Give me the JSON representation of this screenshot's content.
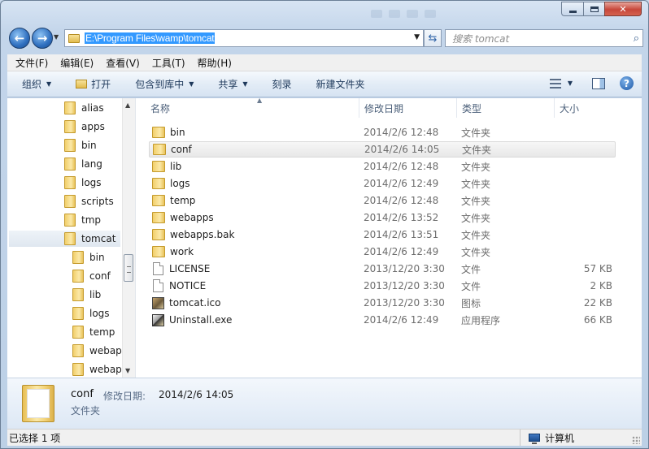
{
  "window": {
    "caption": {
      "minimize": "—",
      "maximize": "□",
      "close": "✕"
    }
  },
  "address": {
    "path": "E:\\Program Files\\wamp\\tomcat",
    "back_icon": "arrow-left-icon",
    "forward_icon": "arrow-right-icon",
    "refresh_icon": "refresh-icon"
  },
  "search": {
    "placeholder": "搜索 tomcat"
  },
  "menu": [
    "文件(F)",
    "编辑(E)",
    "查看(V)",
    "工具(T)",
    "帮助(H)"
  ],
  "toolbar": {
    "organize": "组织",
    "open": "打开",
    "include_in_library": "包含到库中",
    "share": "共享",
    "burn": "刻录",
    "new_folder": "新建文件夹"
  },
  "nav_tree": [
    {
      "label": "alias"
    },
    {
      "label": "apps"
    },
    {
      "label": "bin"
    },
    {
      "label": "lang"
    },
    {
      "label": "logs"
    },
    {
      "label": "scripts"
    },
    {
      "label": "tmp"
    },
    {
      "label": "tomcat",
      "selected": true
    },
    {
      "label": "bin",
      "child": true
    },
    {
      "label": "conf",
      "child": true
    },
    {
      "label": "lib",
      "child": true
    },
    {
      "label": "logs",
      "child": true
    },
    {
      "label": "temp",
      "child": true
    },
    {
      "label": "webap",
      "child": true
    },
    {
      "label": "webap",
      "child": true
    }
  ],
  "columns": {
    "name": "名称",
    "modified": "修改日期",
    "type": "类型",
    "size": "大小"
  },
  "files": [
    {
      "name": "bin",
      "modified": "2014/2/6 12:48",
      "type": "文件夹",
      "size": "",
      "icon": "folder"
    },
    {
      "name": "conf",
      "modified": "2014/2/6 14:05",
      "type": "文件夹",
      "size": "",
      "icon": "folder",
      "selected": true
    },
    {
      "name": "lib",
      "modified": "2014/2/6 12:48",
      "type": "文件夹",
      "size": "",
      "icon": "folder"
    },
    {
      "name": "logs",
      "modified": "2014/2/6 12:49",
      "type": "文件夹",
      "size": "",
      "icon": "folder"
    },
    {
      "name": "temp",
      "modified": "2014/2/6 12:48",
      "type": "文件夹",
      "size": "",
      "icon": "folder"
    },
    {
      "name": "webapps",
      "modified": "2014/2/6 13:52",
      "type": "文件夹",
      "size": "",
      "icon": "folder"
    },
    {
      "name": "webapps.bak",
      "modified": "2014/2/6 13:51",
      "type": "文件夹",
      "size": "",
      "icon": "folder"
    },
    {
      "name": "work",
      "modified": "2014/2/6 12:49",
      "type": "文件夹",
      "size": "",
      "icon": "folder"
    },
    {
      "name": "LICENSE",
      "modified": "2013/12/20 3:30",
      "type": "文件",
      "size": "57 KB",
      "icon": "document"
    },
    {
      "name": "NOTICE",
      "modified": "2013/12/20 3:30",
      "type": "文件",
      "size": "2 KB",
      "icon": "document"
    },
    {
      "name": "tomcat.ico",
      "modified": "2013/12/20 3:30",
      "type": "图标",
      "size": "22 KB",
      "icon": "ico"
    },
    {
      "name": "Uninstall.exe",
      "modified": "2014/2/6 12:49",
      "type": "应用程序",
      "size": "66 KB",
      "icon": "exe"
    }
  ],
  "details": {
    "name": "conf",
    "modified_label": "修改日期:",
    "modified_value": "2014/2/6 14:05",
    "type": "文件夹"
  },
  "status": {
    "selection": "已选择 1 项",
    "location": "计算机"
  }
}
